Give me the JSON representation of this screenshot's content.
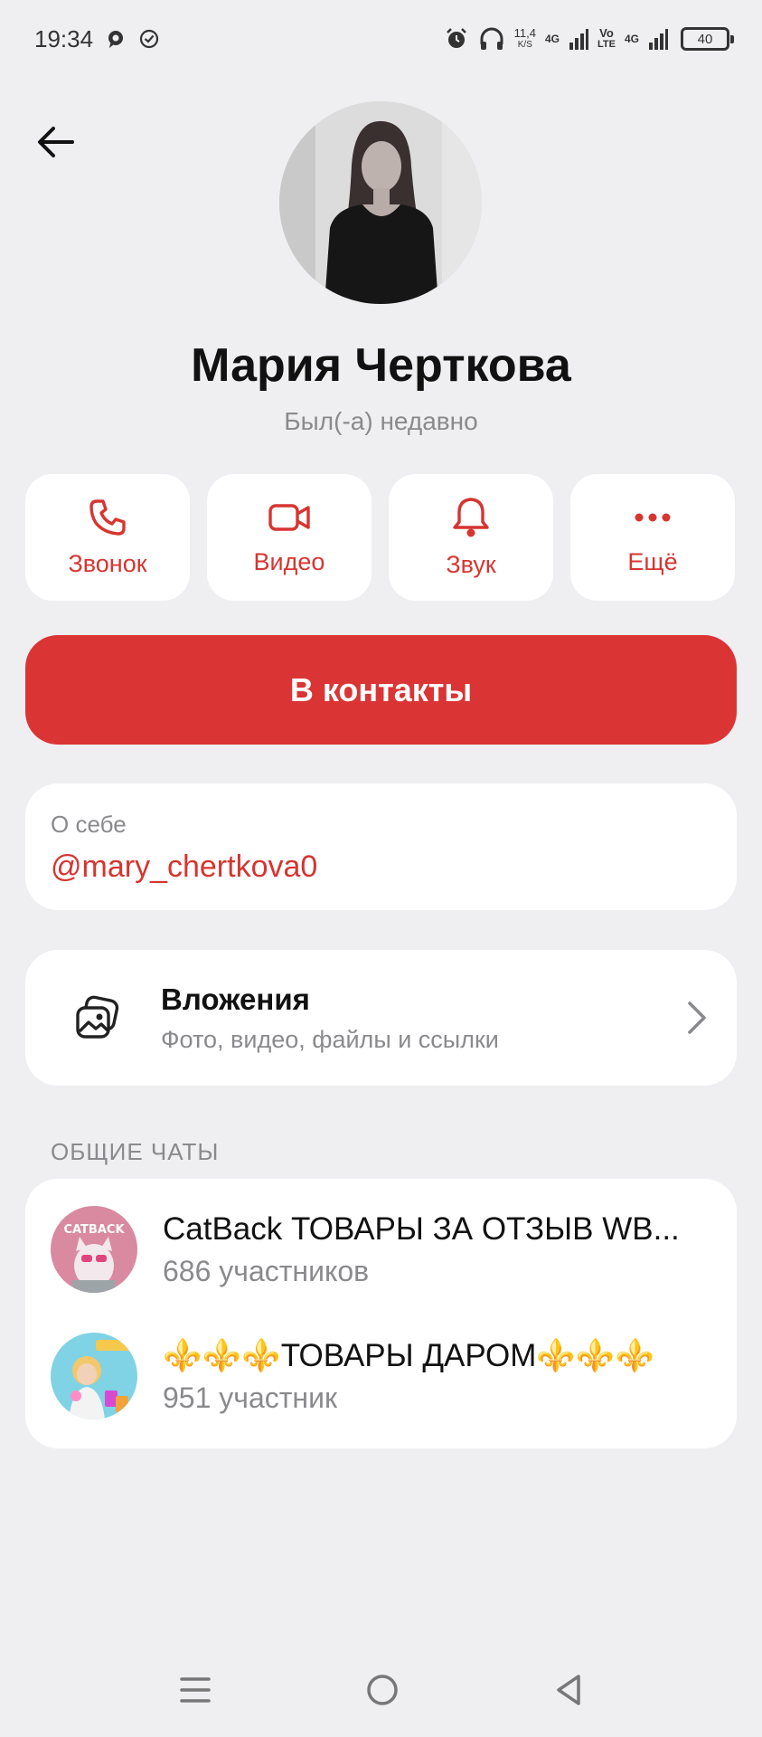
{
  "statusbar": {
    "time": "19:34",
    "speed_value": "11,4",
    "speed_unit": "K/S",
    "net1": "4G",
    "net2_top": "Vo",
    "net2_bottom": "LTE",
    "net3": "4G",
    "battery": "40"
  },
  "profile": {
    "name": "Мария Черткова",
    "status": "Был(-а) недавно"
  },
  "actions": [
    {
      "label": "Звонок",
      "icon": "phone-icon"
    },
    {
      "label": "Видео",
      "icon": "video-icon"
    },
    {
      "label": "Звук",
      "icon": "bell-icon"
    },
    {
      "label": "Ещё",
      "icon": "more-icon"
    }
  ],
  "primary_button": "В контакты",
  "about": {
    "label": "О себе",
    "handle": "@mary_chertkova0"
  },
  "attachments": {
    "title": "Вложения",
    "subtitle": "Фото, видео, файлы и ссылки"
  },
  "common_chats": {
    "section_title": "ОБЩИЕ ЧАТЫ",
    "items": [
      {
        "title": "CatBack ТОВАРЫ ЗА ОТЗЫВ WB...",
        "count": "686 участников",
        "avatar_text": "CATBACK"
      },
      {
        "title": "⚜️⚜️⚜️ТОВАРЫ ДАРОМ⚜️⚜️⚜️",
        "count": "951 участник"
      }
    ]
  },
  "colors": {
    "accent": "#db3434",
    "accent_text": "#d63530",
    "background": "#efeef1",
    "card": "#ffffff",
    "muted": "#8a8a8e"
  }
}
